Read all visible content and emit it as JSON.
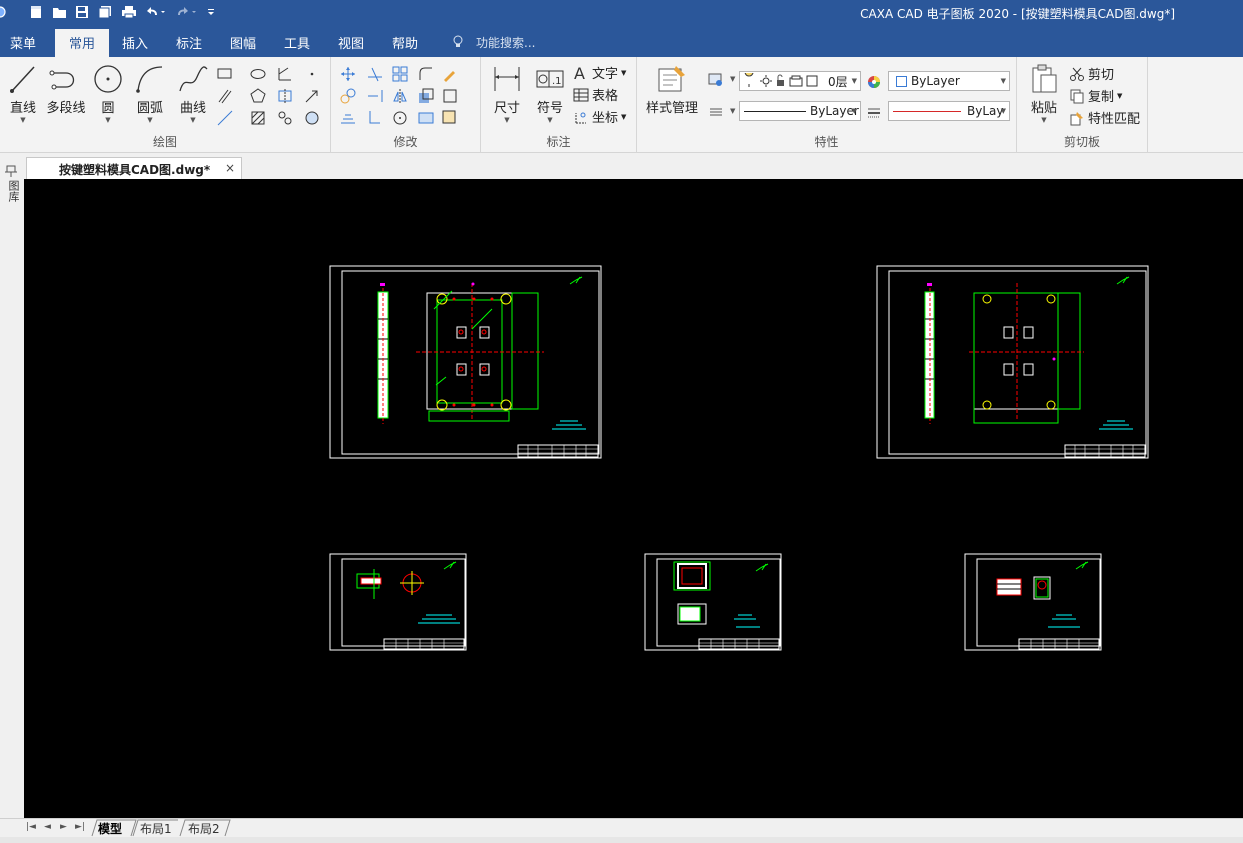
{
  "window": {
    "title": "CAXA CAD 电子图板 2020 - [按键塑料模具CAD图.dwg*]"
  },
  "quick_access": [
    "app-logo-icon",
    "new-file-icon",
    "open-file-icon",
    "save-icon",
    "save-all-icon",
    "print-icon",
    "undo-icon",
    "redo-icon",
    "customize-icon"
  ],
  "ribbon_tabs": [
    {
      "label": "菜单"
    },
    {
      "label": "常用",
      "active": true
    },
    {
      "label": "插入"
    },
    {
      "label": "标注"
    },
    {
      "label": "图幅"
    },
    {
      "label": "工具"
    },
    {
      "label": "视图"
    },
    {
      "label": "帮助"
    }
  ],
  "search": {
    "placeholder": "功能搜索..."
  },
  "groups": {
    "draw": {
      "label": "绘图",
      "buttons": {
        "line": "直线",
        "polyline": "多段线",
        "circle": "圆",
        "arc": "圆弧",
        "curve": "曲线"
      }
    },
    "modify": {
      "label": "修改"
    },
    "annotate": {
      "label": "标注",
      "buttons": {
        "dimension": "尺寸",
        "symbol": "符号",
        "text": "文字",
        "table": "表格",
        "coord": "坐标"
      }
    },
    "properties": {
      "label": "特性",
      "style_manager": "样式管理",
      "layer": "0层",
      "color": "ByLayer",
      "linetype": "ByLayer",
      "lineweight": "ByLay‹"
    },
    "clipboard": {
      "label": "剪切板",
      "paste": "粘贴",
      "cut": "剪切",
      "copy": "复制",
      "match": "特性匹配"
    }
  },
  "document": {
    "tab": "按键塑料模具CAD图.dwg*",
    "close": "×"
  },
  "side_panel": {
    "label": "图库"
  },
  "layouts": {
    "tabs": [
      "模型",
      "布局1",
      "布局2"
    ],
    "active": "模型"
  },
  "colors": {
    "titlebar": "#2b579a",
    "canvas": "#000000",
    "frame": "#ffffff",
    "green": "#00ff00",
    "red": "#ff0000",
    "cyan": "#00ffff",
    "magenta": "#ff00ff"
  }
}
